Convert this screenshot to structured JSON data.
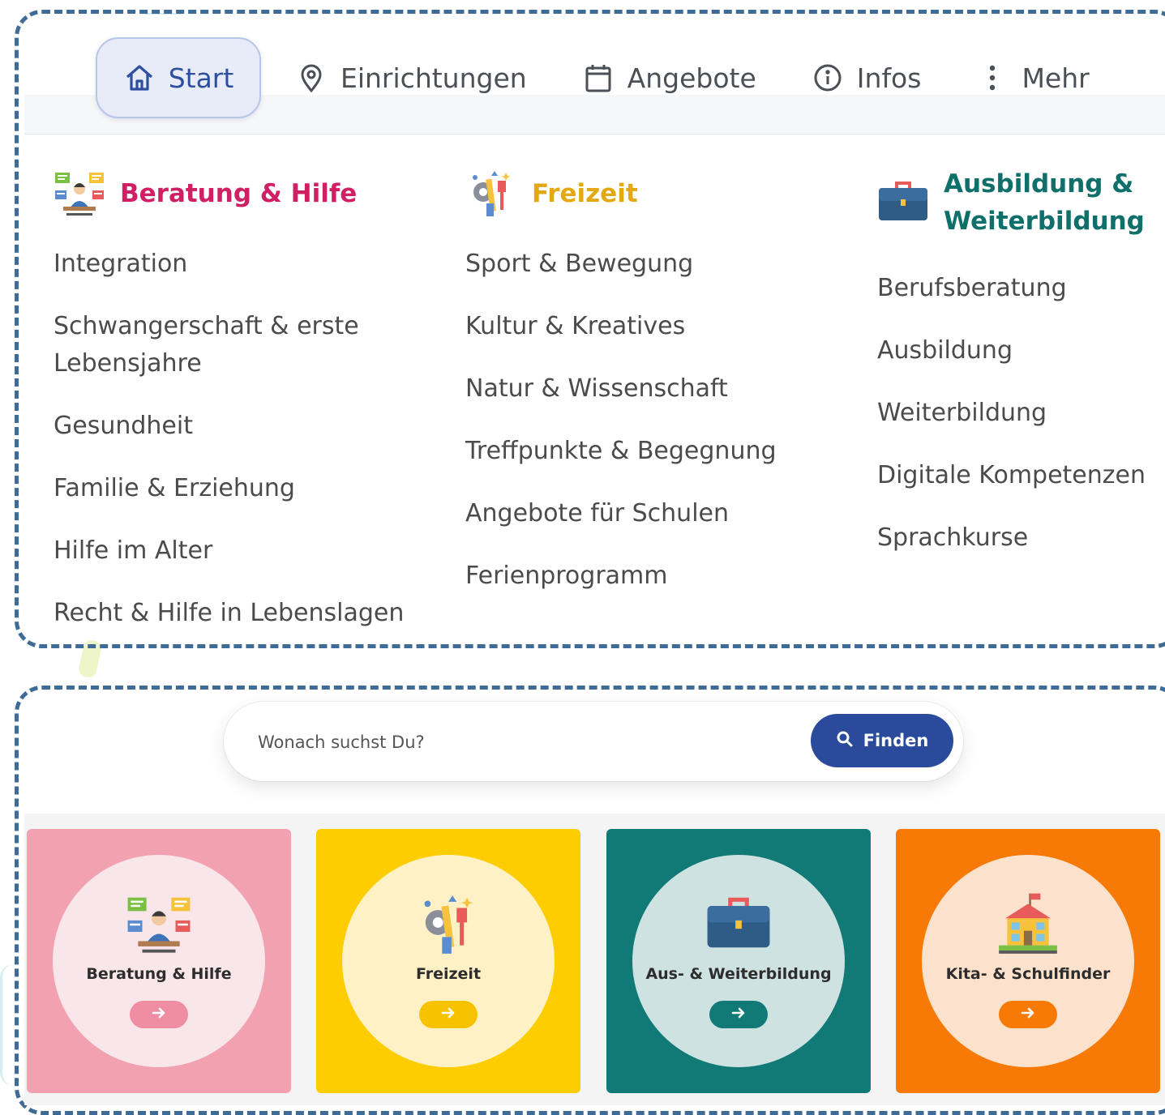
{
  "nav": {
    "items": [
      {
        "label": "Start",
        "icon": "home-icon",
        "active": true
      },
      {
        "label": "Einrichtungen",
        "icon": "map-pin-icon"
      },
      {
        "label": "Angebote",
        "icon": "calendar-icon"
      },
      {
        "label": "Infos",
        "icon": "info-icon"
      },
      {
        "label": "Mehr",
        "icon": "more-vertical-icon"
      }
    ]
  },
  "menu": {
    "beratung": {
      "title": "Beratung & Hilfe",
      "color": "#d11f65",
      "items": [
        "Integration",
        "Schwangerschaft & erste Lebensjahre",
        "Gesundheit",
        "Familie & Erziehung",
        "Hilfe im Alter",
        "Recht & Hilfe in Lebenslagen"
      ]
    },
    "freizeit": {
      "title": "Freizeit",
      "color": "#e3a812",
      "items": [
        "Sport & Bewegung",
        "Kultur & Kreatives",
        "Natur & Wissenschaft",
        "Treffpunkte & Begegnung",
        "Angebote für Schulen",
        "Ferienprogramm"
      ]
    },
    "ausbildung": {
      "title_line1": "Ausbildung &",
      "title_line2": "Weiterbildung",
      "color": "#0f6f6a",
      "items": [
        "Berufsberatung",
        "Ausbildung",
        "Weiterbildung",
        "Digitale Kompetenzen",
        "Sprachkurse"
      ]
    }
  },
  "search": {
    "placeholder": "Wonach suchst Du?",
    "button_label": "Finden"
  },
  "cards": [
    {
      "label": "Beratung & Hilfe",
      "bg": "#f2a1b1",
      "circle": "#f8e6ea",
      "accent": "#ef8ea3"
    },
    {
      "label": "Freizeit",
      "bg": "#fecd00",
      "circle": "#fff1c6",
      "accent": "#f7c300"
    },
    {
      "label": "Aus- & Weiterbildung",
      "bg": "#117a76",
      "circle": "#cfe2e2",
      "accent": "#117a76"
    },
    {
      "label": "Kita- & Schulfinder",
      "bg": "#f87a06",
      "circle": "#fce2cd",
      "accent": "#f87a06"
    }
  ]
}
